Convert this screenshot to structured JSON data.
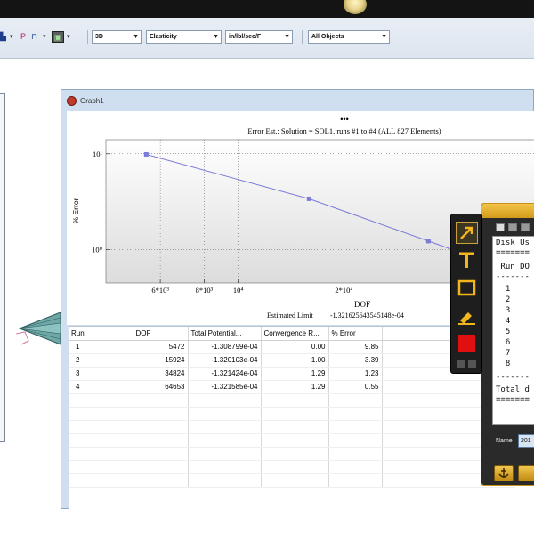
{
  "toolbar": {
    "view_mode": "3D",
    "result_type": "Elasticity",
    "units": "in/lbl/sec/F",
    "filter": "All Objects",
    "icons": [
      "select-icon",
      "print-icon",
      "export-icon",
      "camera-icon"
    ]
  },
  "graph_window": {
    "title": "Graph1",
    "dots": "•••",
    "chart_title": "Error Est.: Solution = SOL1, runs #1 to #4 (ALL 827 Elements)",
    "xlabel": "DOF",
    "ylabel": "% Error",
    "estimated_limit_label": "Estimated Limit",
    "estimated_limit_value": "-1.321625643545148e-04"
  },
  "chart_data": {
    "type": "line",
    "title": "Error Est.: Solution = SOL1, runs #1 to #4 (ALL 827 Elements)",
    "xlabel": "DOF",
    "ylabel": "% Error",
    "x_scale": "log",
    "y_scale": "log",
    "xlim": [
      4200,
      70000
    ],
    "ylim": [
      0.45,
      14
    ],
    "x_ticks": [
      {
        "v": 6000,
        "label": "6*10³"
      },
      {
        "v": 8000,
        "label": "8*10³"
      },
      {
        "v": 10000,
        "label": "10⁴"
      },
      {
        "v": 20000,
        "label": "2*10⁴"
      }
    ],
    "y_ticks": [
      {
        "v": 10,
        "label": "10¹"
      },
      {
        "v": 1,
        "label": "10⁰"
      }
    ],
    "series": [
      {
        "x": [
          5472,
          15924,
          34824,
          64653
        ],
        "y": [
          9.85,
          3.39,
          1.23,
          0.55
        ],
        "color": "#7b7bd8"
      }
    ],
    "grid": true
  },
  "table": {
    "headers": [
      "Run",
      "DOF",
      "Total Potential...",
      "Convergence R...",
      "% Error"
    ],
    "rows": [
      [
        "1",
        "5472",
        "-1.308799e-04",
        "0.00",
        "9.85"
      ],
      [
        "2",
        "15924",
        "-1.320103e-04",
        "1.00",
        "3.39"
      ],
      [
        "3",
        "34824",
        "-1.321424e-04",
        "1.29",
        "1.23"
      ],
      [
        "4",
        "64653",
        "-1.321585e-04",
        "1.29",
        "0.55"
      ]
    ]
  },
  "toolbox": {
    "tools": [
      "arrow-tool-icon",
      "text-tool-icon",
      "rectangle-tool-icon",
      "highlighter-tool-icon",
      "color-swatch-red"
    ],
    "swatch_color": "#e01010"
  },
  "dialog": {
    "console_lines": [
      "Disk Us",
      "=======",
      " Run DO",
      "-------",
      "  1",
      "  2",
      "  3",
      "  4",
      "  5",
      "  6",
      "  7",
      "  8",
      "-------",
      "Total d",
      "======="
    ],
    "name_label": "Name",
    "name_value": "201"
  }
}
